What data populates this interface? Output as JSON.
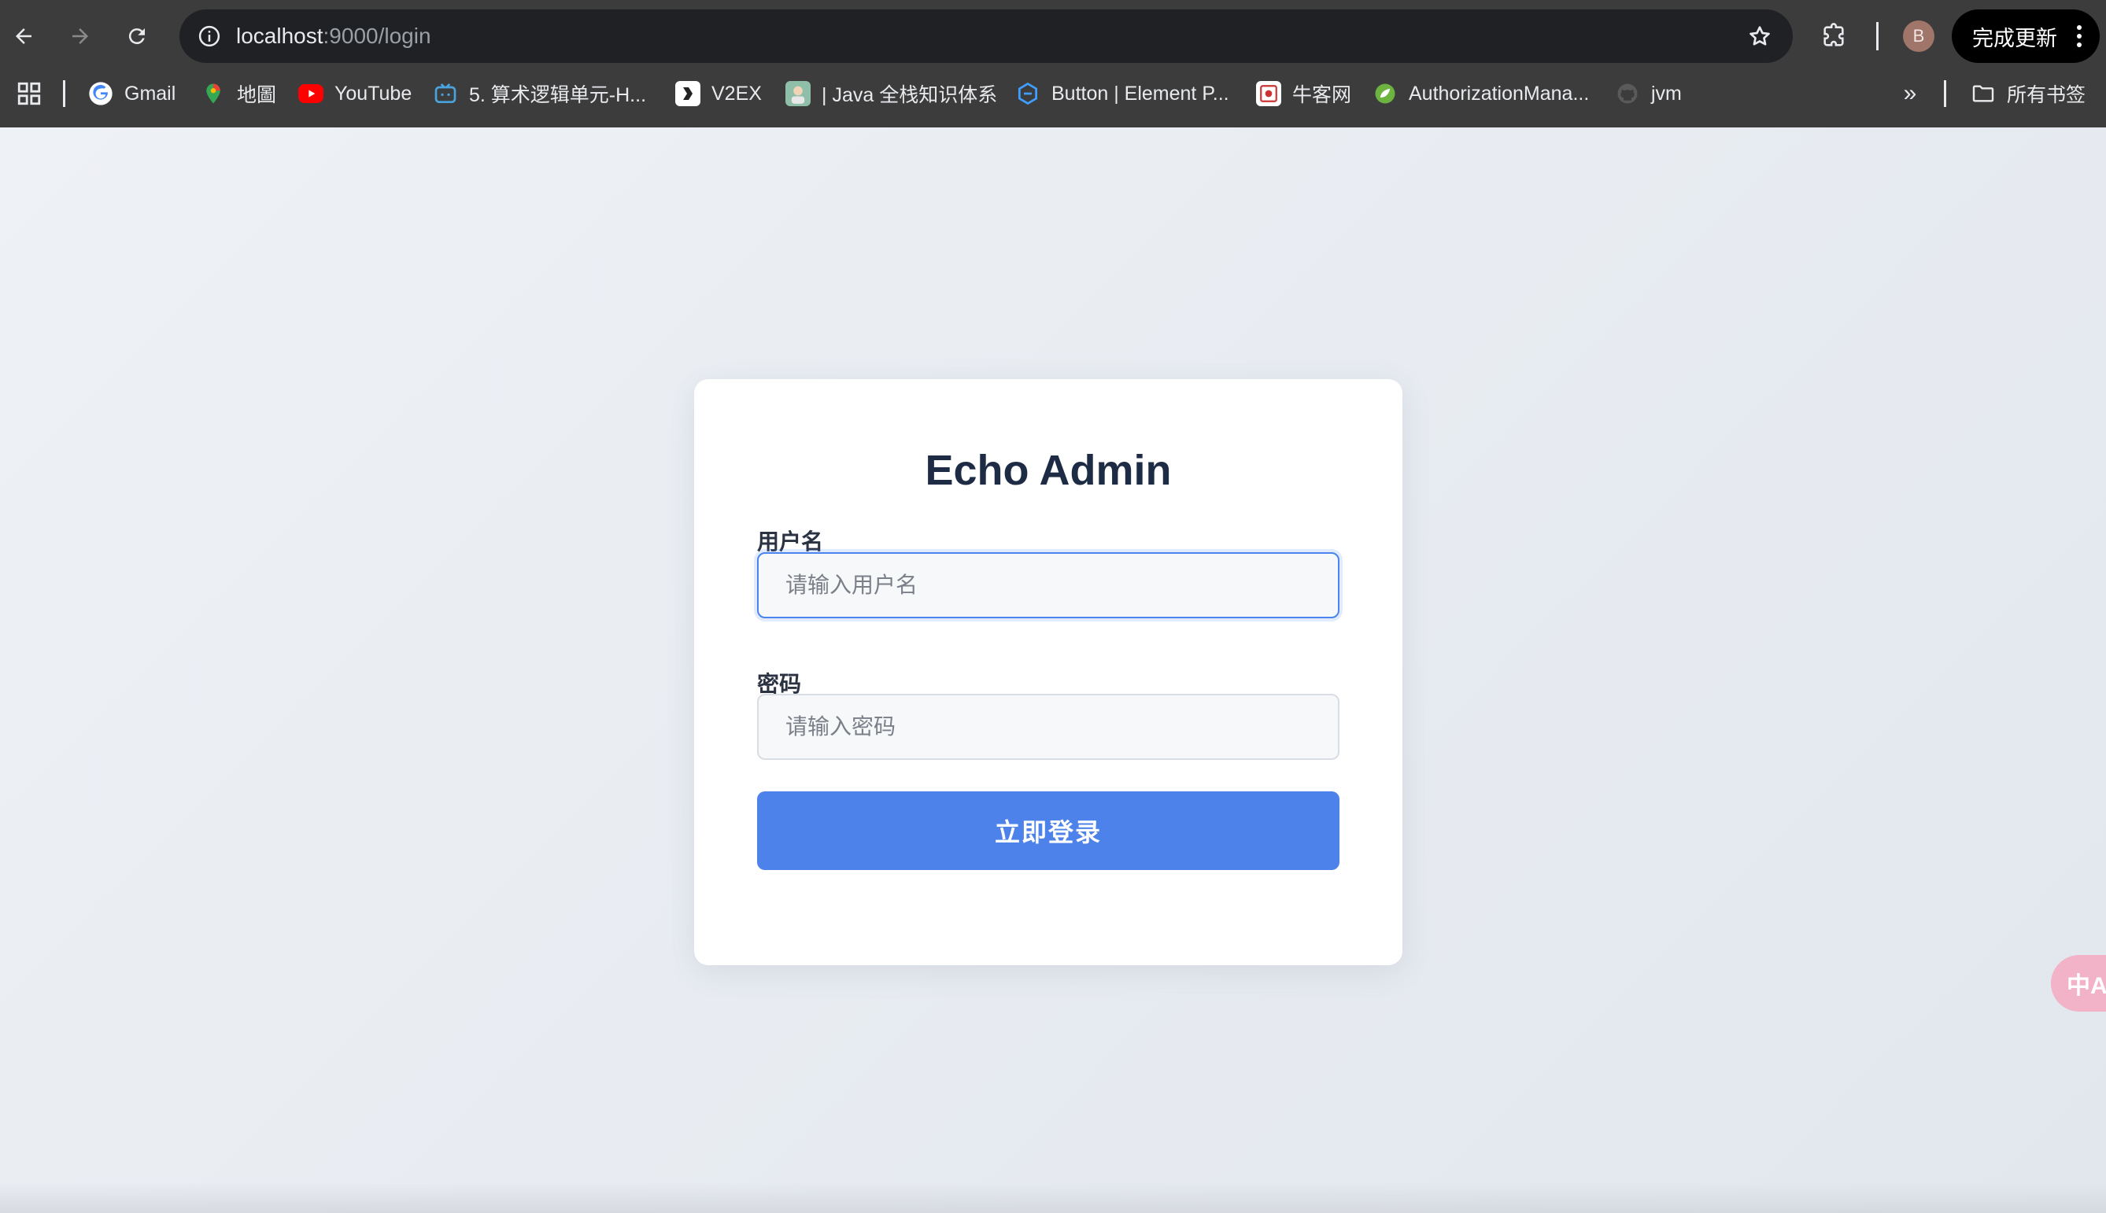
{
  "browser": {
    "url_host": "localhost",
    "url_path": ":9000/login",
    "update_label": "完成更新",
    "avatar_letter": "B"
  },
  "bookmarks": [
    {
      "label": "Gmail",
      "icon": "google-icon",
      "color": "#4285f4"
    },
    {
      "label": "地圖",
      "icon": "maps-pin-icon",
      "color": "#34a853"
    },
    {
      "label": "YouTube",
      "icon": "youtube-icon",
      "color": "#ff0000"
    },
    {
      "label": "5. 算术逻辑单元-H...",
      "icon": "bilibili-tv-icon",
      "color": "#4aa3df"
    },
    {
      "label": "V2EX",
      "icon": "v2ex-icon",
      "color": "#ffffff"
    },
    {
      "label": "| Java 全栈知识体系",
      "icon": "java-site-avatar-icon",
      "color": "#8fbfa8"
    },
    {
      "label": "Button | Element P...",
      "icon": "element-plus-icon",
      "color": "#409eff"
    },
    {
      "label": "牛客网",
      "icon": "nowcoder-icon",
      "color": "#ffffff"
    },
    {
      "label": "AuthorizationMana...",
      "icon": "spring-leaf-icon",
      "color": "#6db33f"
    },
    {
      "label": "jvm",
      "icon": "github-icon",
      "color": "#5a5a5a"
    }
  ],
  "bookmarks_folder_label": "所有书签",
  "login": {
    "title": "Echo Admin",
    "username_label": "用户名",
    "username_placeholder": "请输入用户名",
    "password_label": "密码",
    "password_placeholder": "请输入密码",
    "submit_label": "立即登录"
  },
  "translate_fab_label": "中A",
  "colors": {
    "primary": "#4d82ea",
    "title": "#1e2b45",
    "chrome_bg": "#3c3c3c"
  }
}
